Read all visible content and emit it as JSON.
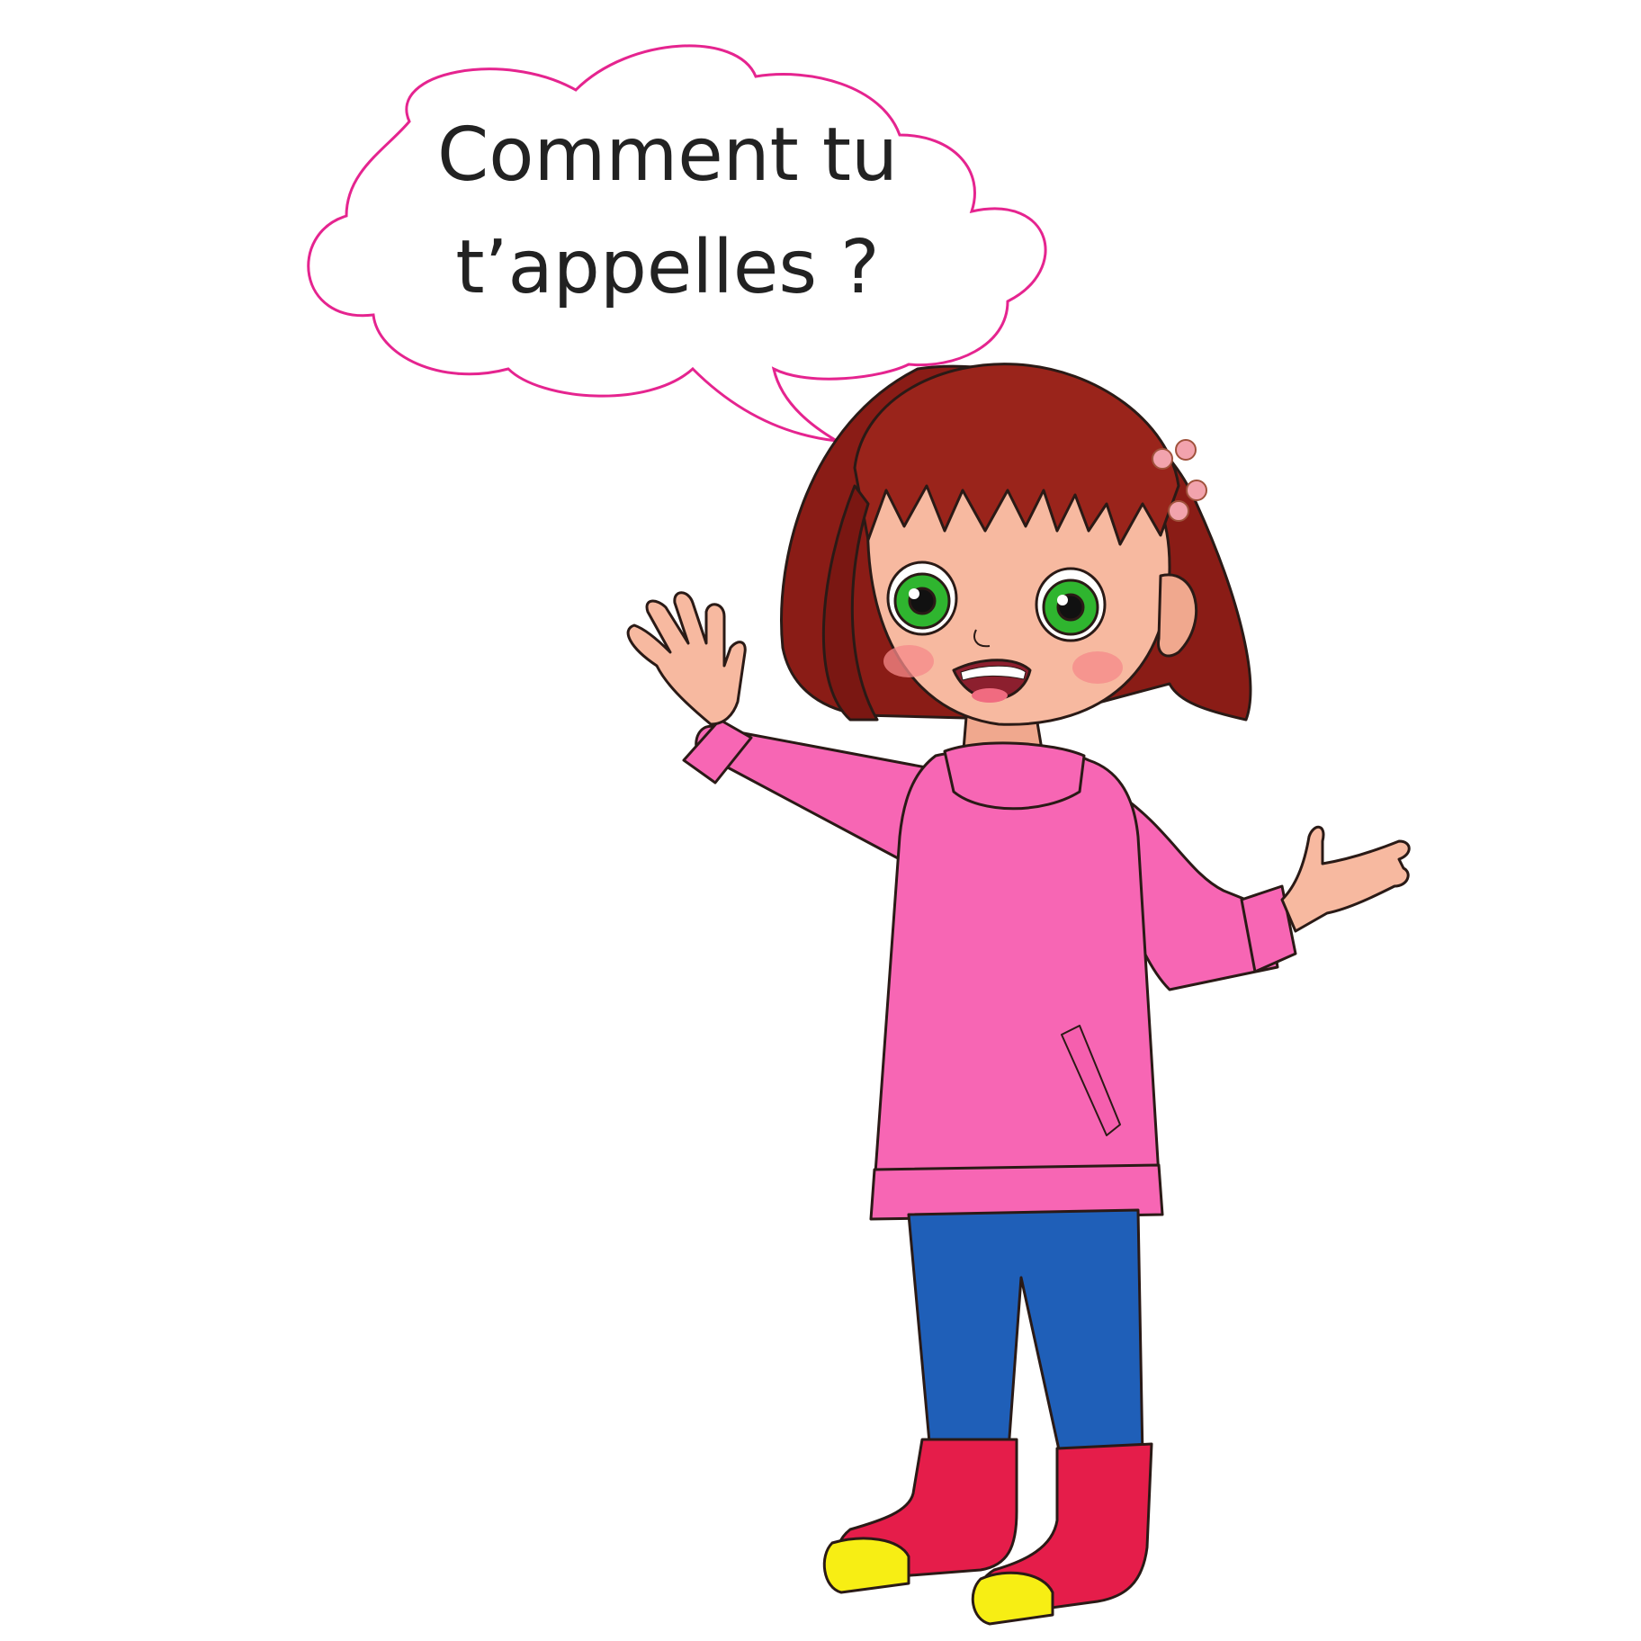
{
  "speech_bubble": {
    "line1": "Comment tu",
    "line2": "t’appelles ?",
    "outline_color": "#e5248f"
  },
  "colors": {
    "hair": "#8a1c16",
    "skin": "#f7b9a0",
    "sweater": "#f766b4",
    "leggings": "#1f5fb8",
    "boots": "#e51d4a",
    "boot_soles": "#f7ee14",
    "eyes": "#2fb52f",
    "hair_clips": "#f2a3ad"
  }
}
